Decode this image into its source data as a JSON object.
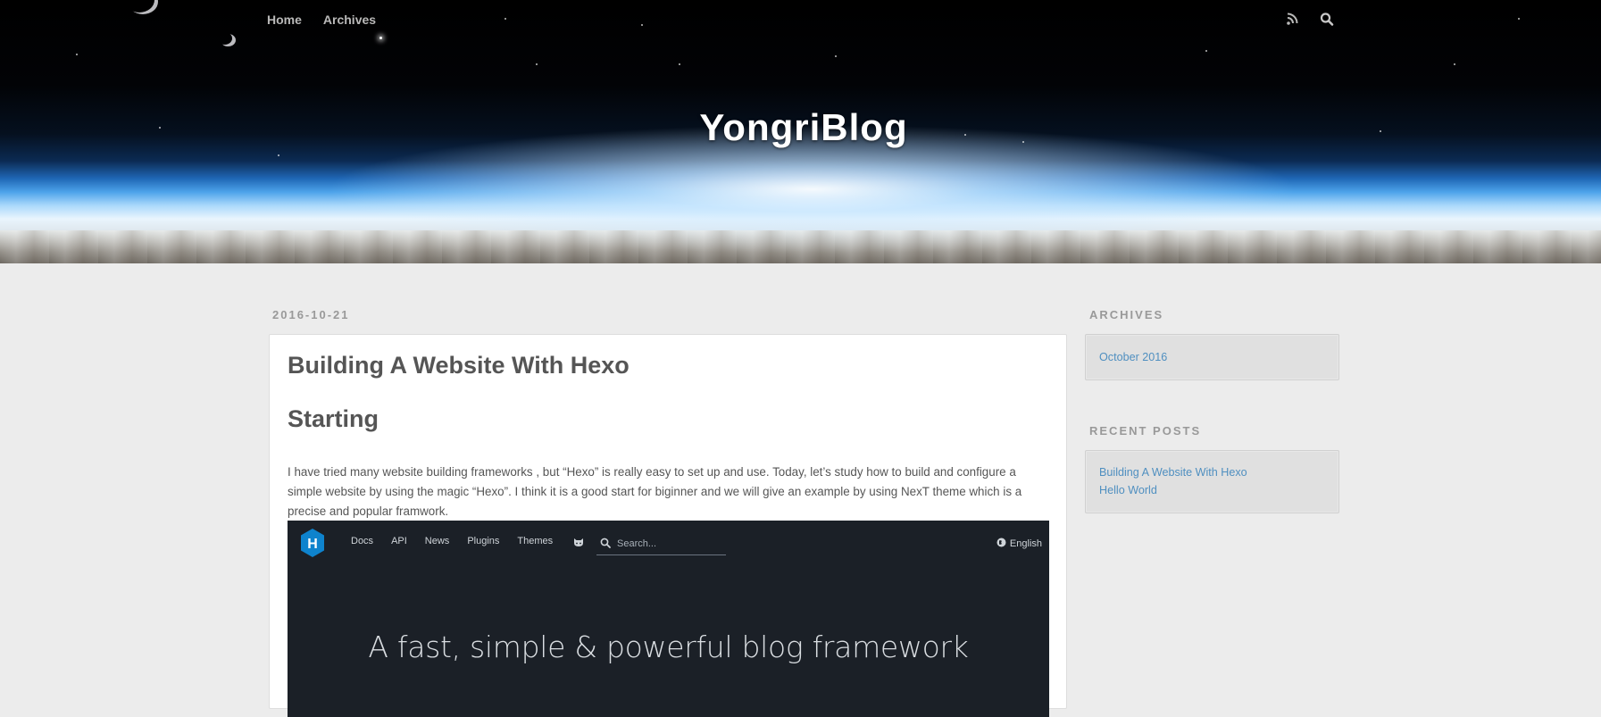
{
  "site": {
    "title": "YongriBlog"
  },
  "nav": {
    "links": [
      "Home",
      "Archives"
    ],
    "icons": [
      "rss-icon",
      "search-icon"
    ]
  },
  "post": {
    "date": "2016-10-21",
    "title": "Building A Website With Hexo",
    "subheading": "Starting",
    "body": "I have tried many website building frameworks , but “Hexo” is really easy to set up and use. Today, let’s study how to build and configure a simple website by using the magic “Hexo”. I think it is a good start for biginner and we will give an example by using NexT theme which is a precise and popular framwork.",
    "image": {
      "logo_letter": "H",
      "nav": [
        "Docs",
        "API",
        "News",
        "Plugins",
        "Themes"
      ],
      "search_placeholder": "Search...",
      "language": "English",
      "tagline": "A fast, simple & powerful blog framework",
      "accent_color": "#0e83cd"
    }
  },
  "sidebar": {
    "archives": {
      "heading": "ARCHIVES",
      "items": [
        "October 2016"
      ]
    },
    "recent_posts": {
      "heading": "RECENT POSTS",
      "items": [
        "Building A Website With Hexo",
        "Hello World"
      ]
    }
  },
  "colors": {
    "link": "#4f8fc0",
    "page_bg": "#ececec",
    "hexo_bg": "#1b2027"
  }
}
